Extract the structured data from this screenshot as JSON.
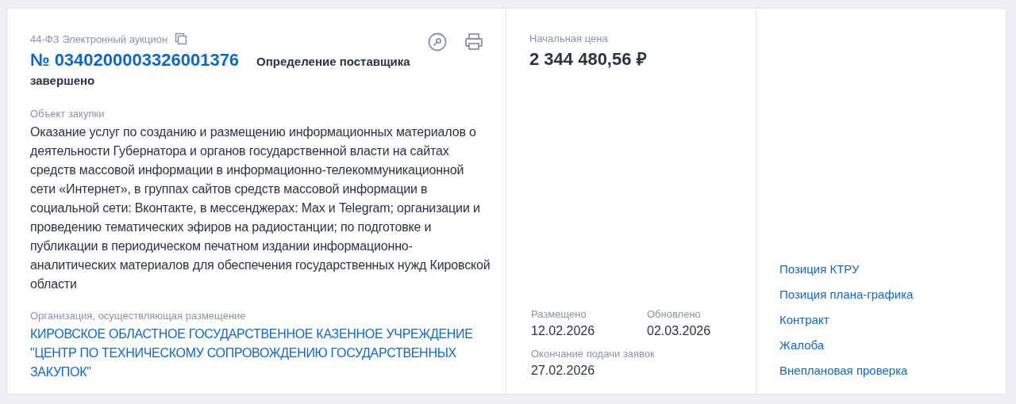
{
  "procurement": {
    "law_type": "44-ФЗ Электронный аукцион",
    "number": "№ 0340200003326001376",
    "status": [
      "Определение поставщика",
      "завершено"
    ],
    "object_label": "Объект закупки",
    "object_text": "Оказание услуг по созданию и размещению информационных материалов о деятельности Губернатора и органов государственной власти на сайтах средств массовой информации в информационно-телекоммуникационной сети «Интернет», в группах сайтов средств массовой информации в социальной сети: Вконтакте, в мессенджерах: Max и Telegram; организации и проведению тематических эфиров на радиостанции; по подготовке и публикации в периодическом печатном издании информационно-аналитических материалов для обеспечения государственных нужд Кировской области",
    "organization_label": "Организация, осуществляющая размещение",
    "organization": "КИРОВСКОЕ ОБЛАСТНОЕ ГОСУДАРСТВЕННОЕ КАЗЕННОЕ УЧРЕЖДЕНИЕ \"ЦЕНТР ПО ТЕХНИЧЕСКОМУ СОПРОВОЖДЕНИЮ ГОСУДАРСТВЕННЫХ ЗАКУПОК\""
  },
  "price": {
    "label": "Начальная цена",
    "value": "2 344 480,56 ₽"
  },
  "dates": [
    {
      "label": "Размещено",
      "value": "12.02.2026"
    },
    {
      "label": "Обновлено",
      "value": "02.03.2026"
    },
    {
      "label": "Окончание подачи заявок",
      "value": "27.02.2026"
    }
  ],
  "links": [
    "Позиция КТРУ",
    "Позиция плана-графика",
    "Контракт",
    "Жалоба",
    "Внеплановая проверка"
  ]
}
